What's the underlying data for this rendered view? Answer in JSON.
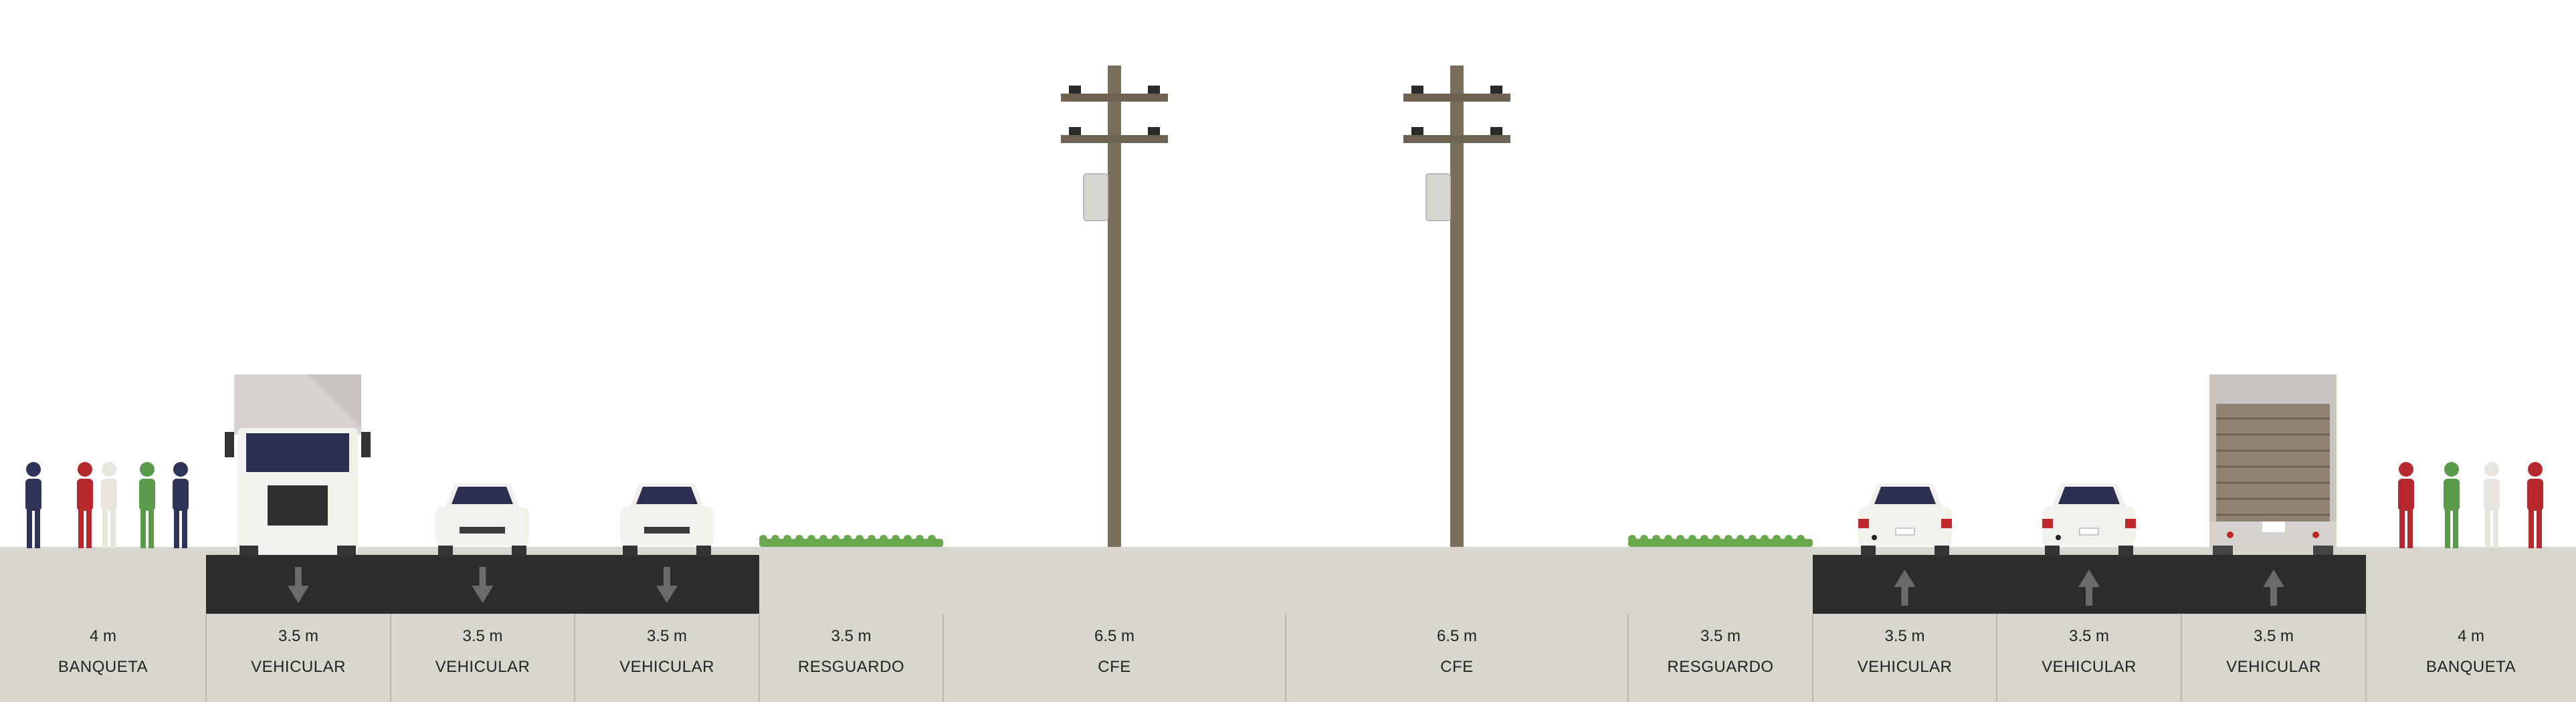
{
  "street": {
    "segments": [
      {
        "width": "4 m",
        "name": "BANQUETA",
        "kind": "sidewalk",
        "direction": ""
      },
      {
        "width": "3.5 m",
        "name": "VEHICULAR",
        "kind": "lane",
        "direction": "down"
      },
      {
        "width": "3.5 m",
        "name": "VEHICULAR",
        "kind": "lane",
        "direction": "down"
      },
      {
        "width": "3.5 m",
        "name": "VEHICULAR",
        "kind": "lane",
        "direction": "down"
      },
      {
        "width": "3.5 m",
        "name": "RESGUARDO",
        "kind": "buffer",
        "direction": ""
      },
      {
        "width": "6.5 m",
        "name": "CFE",
        "kind": "utility",
        "direction": ""
      },
      {
        "width": "6.5 m",
        "name": "CFE",
        "kind": "utility",
        "direction": ""
      },
      {
        "width": "3.5 m",
        "name": "RESGUARDO",
        "kind": "buffer",
        "direction": ""
      },
      {
        "width": "3.5 m",
        "name": "VEHICULAR",
        "kind": "lane",
        "direction": "up"
      },
      {
        "width": "3.5 m",
        "name": "VEHICULAR",
        "kind": "lane",
        "direction": "up"
      },
      {
        "width": "3.5 m",
        "name": "VEHICULAR",
        "kind": "lane",
        "direction": "up"
      },
      {
        "width": "4 m",
        "name": "BANQUETA",
        "kind": "sidewalk",
        "direction": ""
      }
    ]
  },
  "colors": {
    "ground": "#d9d5cf",
    "asphalt": "#2b2d2b",
    "arrow": "#6b6b6b",
    "grass": "#6aa84f",
    "pole": "#7a6e5c",
    "divider": "#bdb8b0"
  },
  "icons": [
    "pedestrian-icon",
    "truck-icon",
    "car-icon",
    "utility-pole-icon",
    "direction-arrow-icon",
    "grass-icon"
  ]
}
